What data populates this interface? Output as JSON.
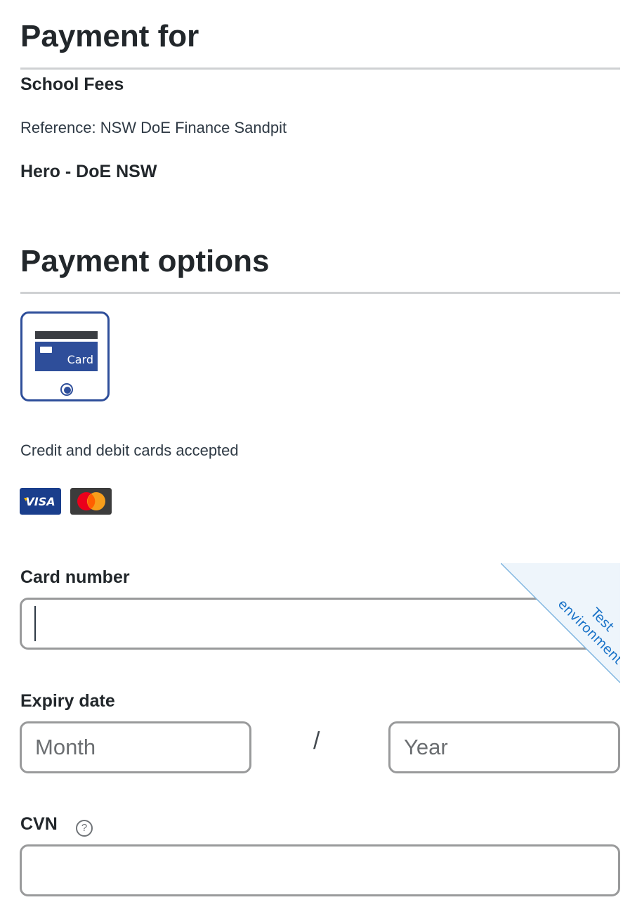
{
  "payment_for": {
    "heading": "Payment for",
    "item": "School Fees",
    "reference": "Reference: NSW DoE Finance Sandpit",
    "merchant": "Hero - DoE NSW"
  },
  "payment_options": {
    "heading": "Payment options",
    "options": [
      {
        "label": "Card",
        "icon": "credit-card-icon",
        "selected": true
      }
    ],
    "accepted_text": "Credit and debit cards accepted",
    "brands": [
      {
        "label": "VISA",
        "icon": "visa-logo",
        "color": "#1a3e8c"
      },
      {
        "label": "",
        "icon": "mastercard-logo",
        "color": "#3c3c3c"
      }
    ]
  },
  "form": {
    "card_number": {
      "label": "Card number",
      "value": "",
      "placeholder": ""
    },
    "expiry": {
      "label": "Expiry date",
      "month_placeholder": "Month",
      "separator": "/",
      "year_placeholder": "Year"
    },
    "cvn": {
      "label": "CVN",
      "help_icon": "question-circle-icon",
      "help_glyph": "?",
      "value": ""
    }
  },
  "ribbon": {
    "line1": "Test",
    "line2": "environment"
  },
  "colors": {
    "primary": "#2e4e9a",
    "ribbon_text": "#1a73c8",
    "ribbon_bg": "#eef5fb",
    "input_border": "#999a9b",
    "divider": "#cfd1d3"
  }
}
